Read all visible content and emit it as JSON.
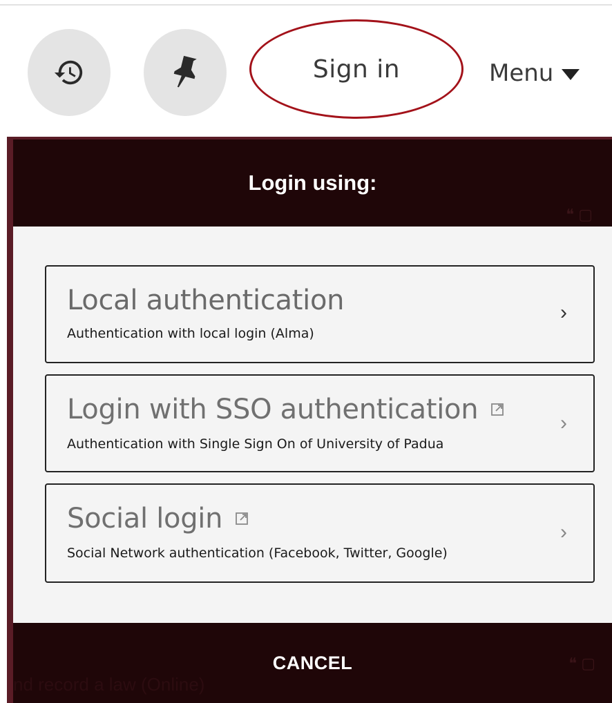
{
  "header": {
    "history_icon": "history-icon",
    "pin_icon": "pushpin-icon",
    "sign_in_label": "Sign in",
    "menu_label": "Menu"
  },
  "modal": {
    "title": "Login using:",
    "options": [
      {
        "title": "Local authentication",
        "description": "Authentication with local login (Alma)",
        "external": false
      },
      {
        "title": "Login with SSO authentication",
        "description": "Authentication with Single Sign On of University of Padua",
        "external": true
      },
      {
        "title": "Social login",
        "description": "Social Network authentication (Facebook, Twitter, Google)",
        "external": true
      }
    ],
    "cancel_label": "CANCEL"
  },
  "background": {
    "partial_text": "nd record a law (Online)"
  },
  "colors": {
    "modal_dark": "#1f0608",
    "modal_frame": "#5a1c26",
    "annotation_ring": "#a3121a"
  }
}
